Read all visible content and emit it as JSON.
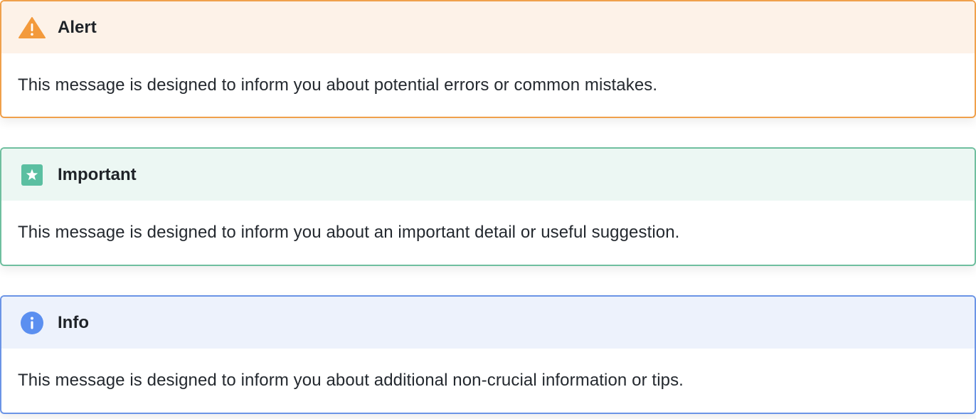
{
  "callouts": [
    {
      "id": "alert",
      "title": "Alert",
      "icon": "warning-triangle-icon",
      "color": "#f39a3c",
      "message": "This message is designed to inform you about potential errors or common mistakes."
    },
    {
      "id": "important",
      "title": "Important",
      "icon": "star-square-icon",
      "color": "#5bbfa1",
      "message": "This message is designed to inform you about an important detail or useful suggestion."
    },
    {
      "id": "info",
      "title": "Info",
      "icon": "info-circle-icon",
      "color": "#5b8ff0",
      "message": "This message is designed to inform you about additional non-crucial information or tips."
    }
  ]
}
